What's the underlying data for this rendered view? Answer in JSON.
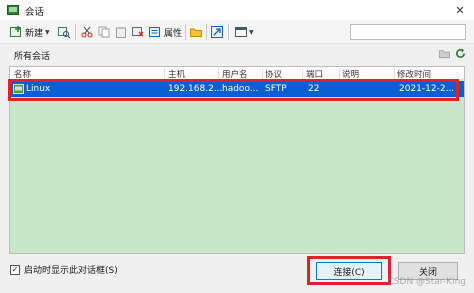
{
  "window": {
    "title": "会话",
    "close_glyph": "✕"
  },
  "toolbar": {
    "new_label": "新建",
    "properties_label": "属性"
  },
  "section": {
    "label": "所有会话"
  },
  "table": {
    "columns": [
      "名称",
      "主机",
      "用户名",
      "协议",
      "端口",
      "说明",
      "修改时间"
    ],
    "rows": [
      {
        "name": "Linux",
        "host": "192.168.2...",
        "user": "hadoo...",
        "protocol": "SFTP",
        "port": "22",
        "desc": "",
        "modified": "2021-12-2..."
      }
    ]
  },
  "footer": {
    "checkbox_label": "启动时显示此对话框(S)",
    "checkbox_checked": true,
    "connect_label": "连接(C)",
    "close_label": "关闭"
  },
  "watermark": "CSDN @Star-King",
  "colors": {
    "selection": "#0a5fd3",
    "list_bg": "#c8e6c9",
    "highlight": "#e0202a"
  }
}
